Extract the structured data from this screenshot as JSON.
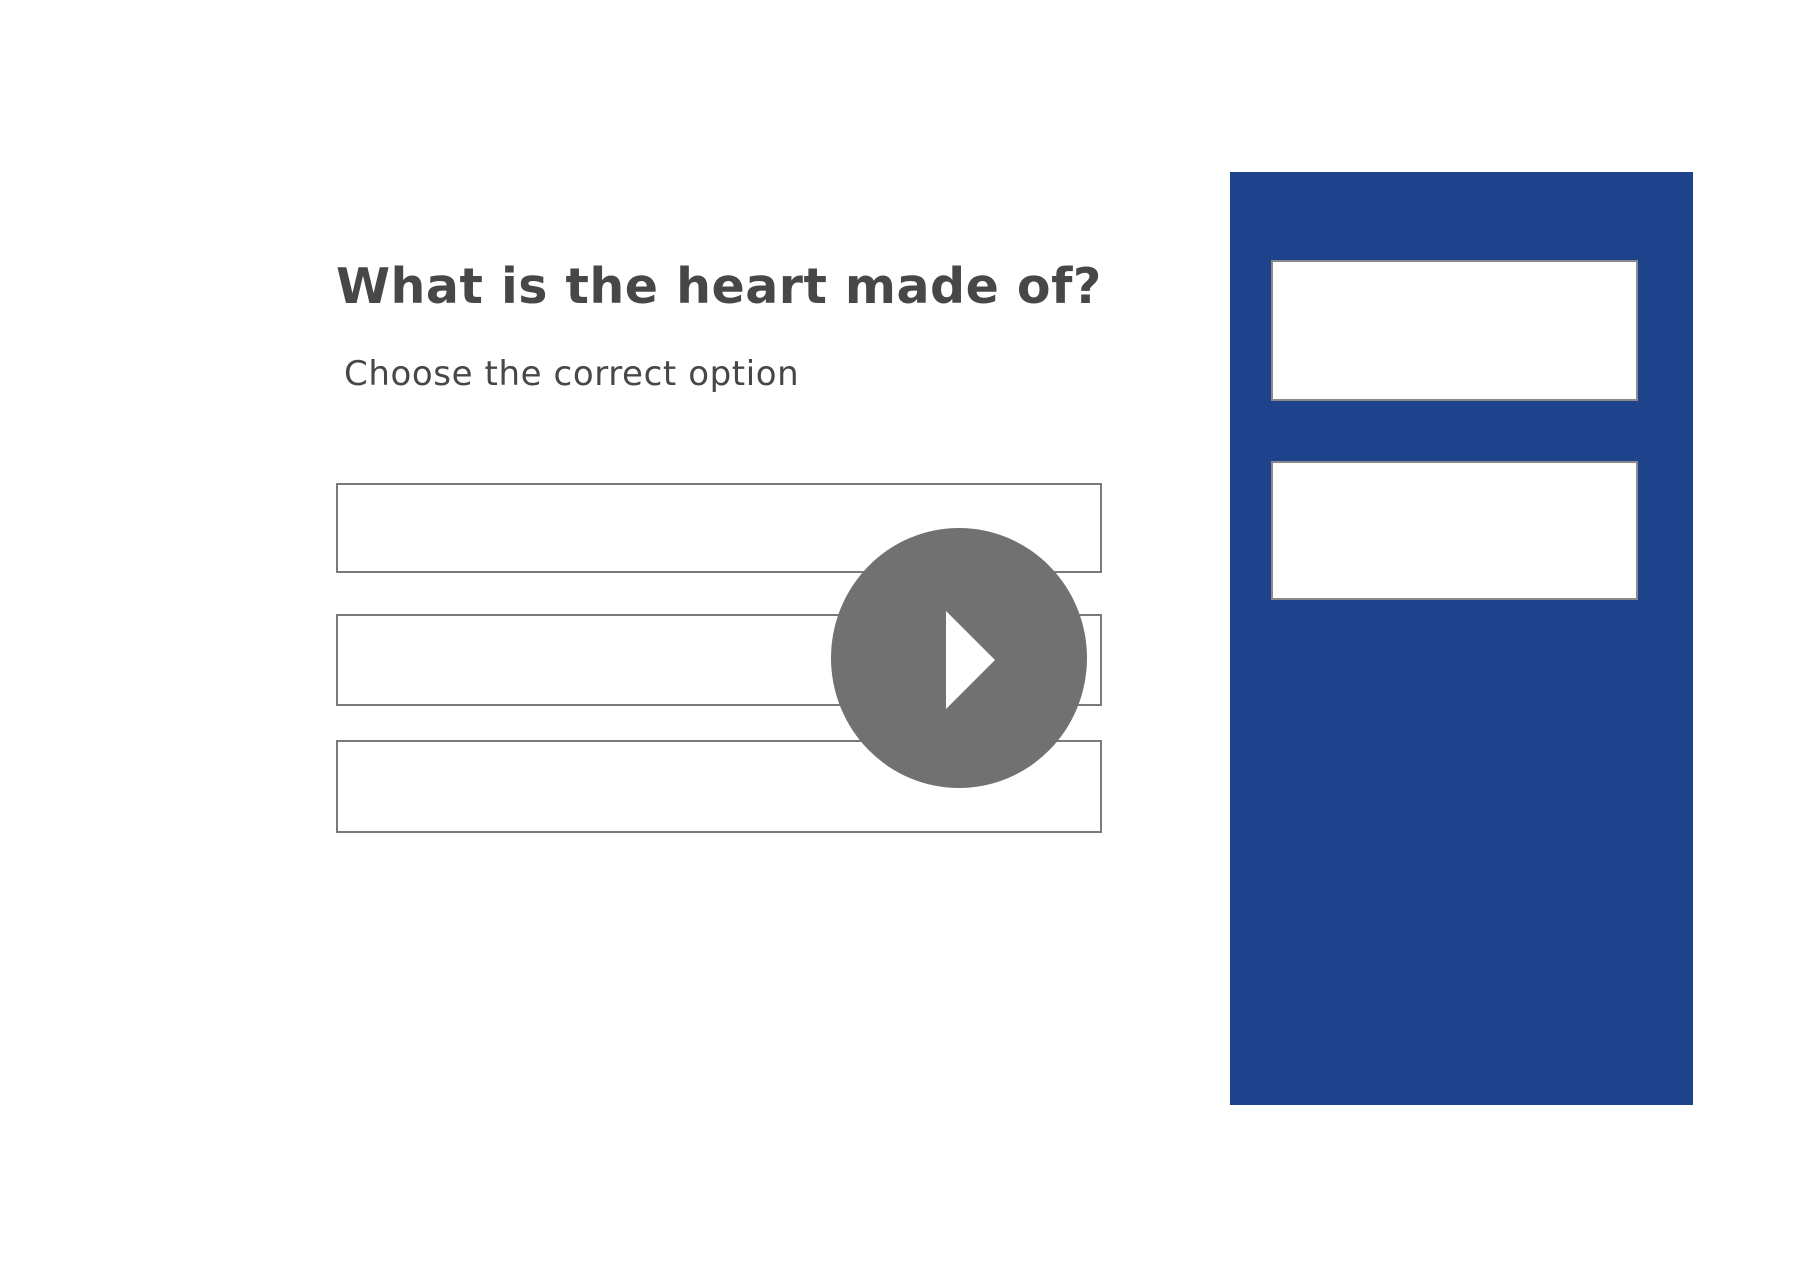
{
  "question": {
    "title": "What is the heart made of?",
    "instruction": "Choose the correct option"
  },
  "options": [
    {
      "label": ""
    },
    {
      "label": ""
    },
    {
      "label": ""
    }
  ],
  "play_button": {
    "icon": "play-icon"
  },
  "side_panel": {
    "background_color": "#1f428c",
    "drop_zones": [
      {
        "label": ""
      },
      {
        "label": ""
      }
    ]
  },
  "colors": {
    "text": "#474747",
    "option_border": "#7a7a7a",
    "play_button": "#717171"
  }
}
